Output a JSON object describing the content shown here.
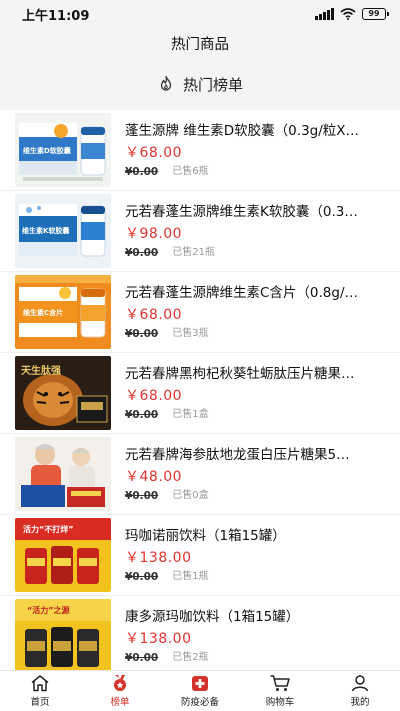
{
  "status_bar": {
    "time": "上午11:09",
    "battery": "99"
  },
  "header": {
    "title": "热门商品"
  },
  "section": {
    "title": "热门榜单",
    "icon": "flame-icon"
  },
  "products": [
    {
      "name": "蓬生源牌 维生素D软胶囊（0.3g/粒X…",
      "price": "￥68.00",
      "original_price": "¥0.00",
      "sold": "已售6瓶"
    },
    {
      "name": "元若春蓬生源牌维生素K软胶囊（0.3…",
      "price": "￥98.00",
      "original_price": "¥0.00",
      "sold": "已售21瓶"
    },
    {
      "name": "元若春蓬生源牌维生素C含片（0.8g/…",
      "price": "￥68.00",
      "original_price": "¥0.00",
      "sold": "已售3瓶"
    },
    {
      "name": "元若春牌黑枸杞秋葵牡蛎肽压片糖果…",
      "price": "￥68.00",
      "original_price": "¥0.00",
      "sold": "已售1盒"
    },
    {
      "name": "元若春牌海参肽地龙蛋白压片糖果5…",
      "price": "￥48.00",
      "original_price": "¥0.00",
      "sold": "已售0盒"
    },
    {
      "name": "玛咖诺丽饮料（1箱15罐）",
      "price": "￥138.00",
      "original_price": "¥0.00",
      "sold": "已售1瓶"
    },
    {
      "name": "康多源玛咖饮料（1箱15罐）",
      "price": "￥138.00",
      "original_price": "¥0.00",
      "sold": "已售2瓶"
    }
  ],
  "thumb_text": {
    "vitd": "维生素D软胶囊",
    "vitk": "维生素K软胶囊",
    "vitc": "维生素C含片",
    "tiger": "天生肽强",
    "drink1": "活力“不打烊”",
    "drink2": "“活力”之源"
  },
  "tabs": [
    {
      "label": "首页",
      "icon": "home-icon",
      "active": false
    },
    {
      "label": "榜单",
      "icon": "medal-icon",
      "active": true
    },
    {
      "label": "防疫必备",
      "icon": "medical-kit-icon",
      "active": false
    },
    {
      "label": "购物车",
      "icon": "cart-icon",
      "active": false
    },
    {
      "label": "我的",
      "icon": "user-icon",
      "active": false
    }
  ],
  "colors": {
    "accent": "#d6322c",
    "price": "#e0342f",
    "header_bg": "#f4f4f4"
  }
}
